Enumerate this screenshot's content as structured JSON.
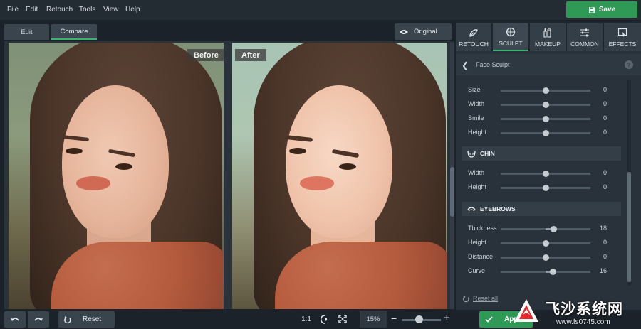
{
  "menu": [
    "File",
    "Edit",
    "Retouch",
    "Tools",
    "View",
    "Help"
  ],
  "save_label": "Save",
  "view_tabs": {
    "edit": "Edit",
    "compare": "Compare"
  },
  "original_label": "Original",
  "labels": {
    "before": "Before",
    "after": "After"
  },
  "right_tabs": [
    "RETOUCH",
    "SCULPT",
    "MAKEUP",
    "COMMON",
    "EFFECTS"
  ],
  "panel_title": "Face Sculpt",
  "help_glyph": "?",
  "face_rows": [
    {
      "label": "Size",
      "value": "0",
      "level": 0.5
    },
    {
      "label": "Width",
      "value": "0",
      "level": 0.5
    },
    {
      "label": "Smile",
      "value": "0",
      "level": 0.5
    },
    {
      "label": "Height",
      "value": "0",
      "level": 0.5
    }
  ],
  "chin": {
    "title": "CHIN",
    "rows": [
      {
        "label": "Width",
        "value": "0",
        "level": 0.5
      },
      {
        "label": "Height",
        "value": "0",
        "level": 0.5
      }
    ]
  },
  "eyebrows": {
    "title": "EYEBROWS",
    "rows": [
      {
        "label": "Thickness",
        "value": "18",
        "level": 0.59
      },
      {
        "label": "Height",
        "value": "0",
        "level": 0.5
      },
      {
        "label": "Distance",
        "value": "0",
        "level": 0.5
      },
      {
        "label": "Curve",
        "value": "16",
        "level": 0.58
      }
    ]
  },
  "reset_all_label": "Reset all",
  "bottom": {
    "reset_label": "Reset",
    "ratio_label": "1:1",
    "zoom_value": "15%",
    "zoom_minus": "−",
    "zoom_plus": "+",
    "zoom_level": 0.45
  },
  "apply_label": "App",
  "watermark": {
    "title": "飞沙系统网",
    "url": "www.fs0745.com"
  },
  "colors": {
    "accent": "#3db46d",
    "save": "#2e9a55",
    "bg": "#1b2229",
    "panel": "#29323a"
  },
  "icons": {
    "save": "floppy-icon",
    "original": "eye-icon",
    "undo": "undo-icon",
    "redo": "redo-icon",
    "reset": "reset-icon",
    "face_detect": "face-icon",
    "fit": "fit-screen-icon"
  }
}
